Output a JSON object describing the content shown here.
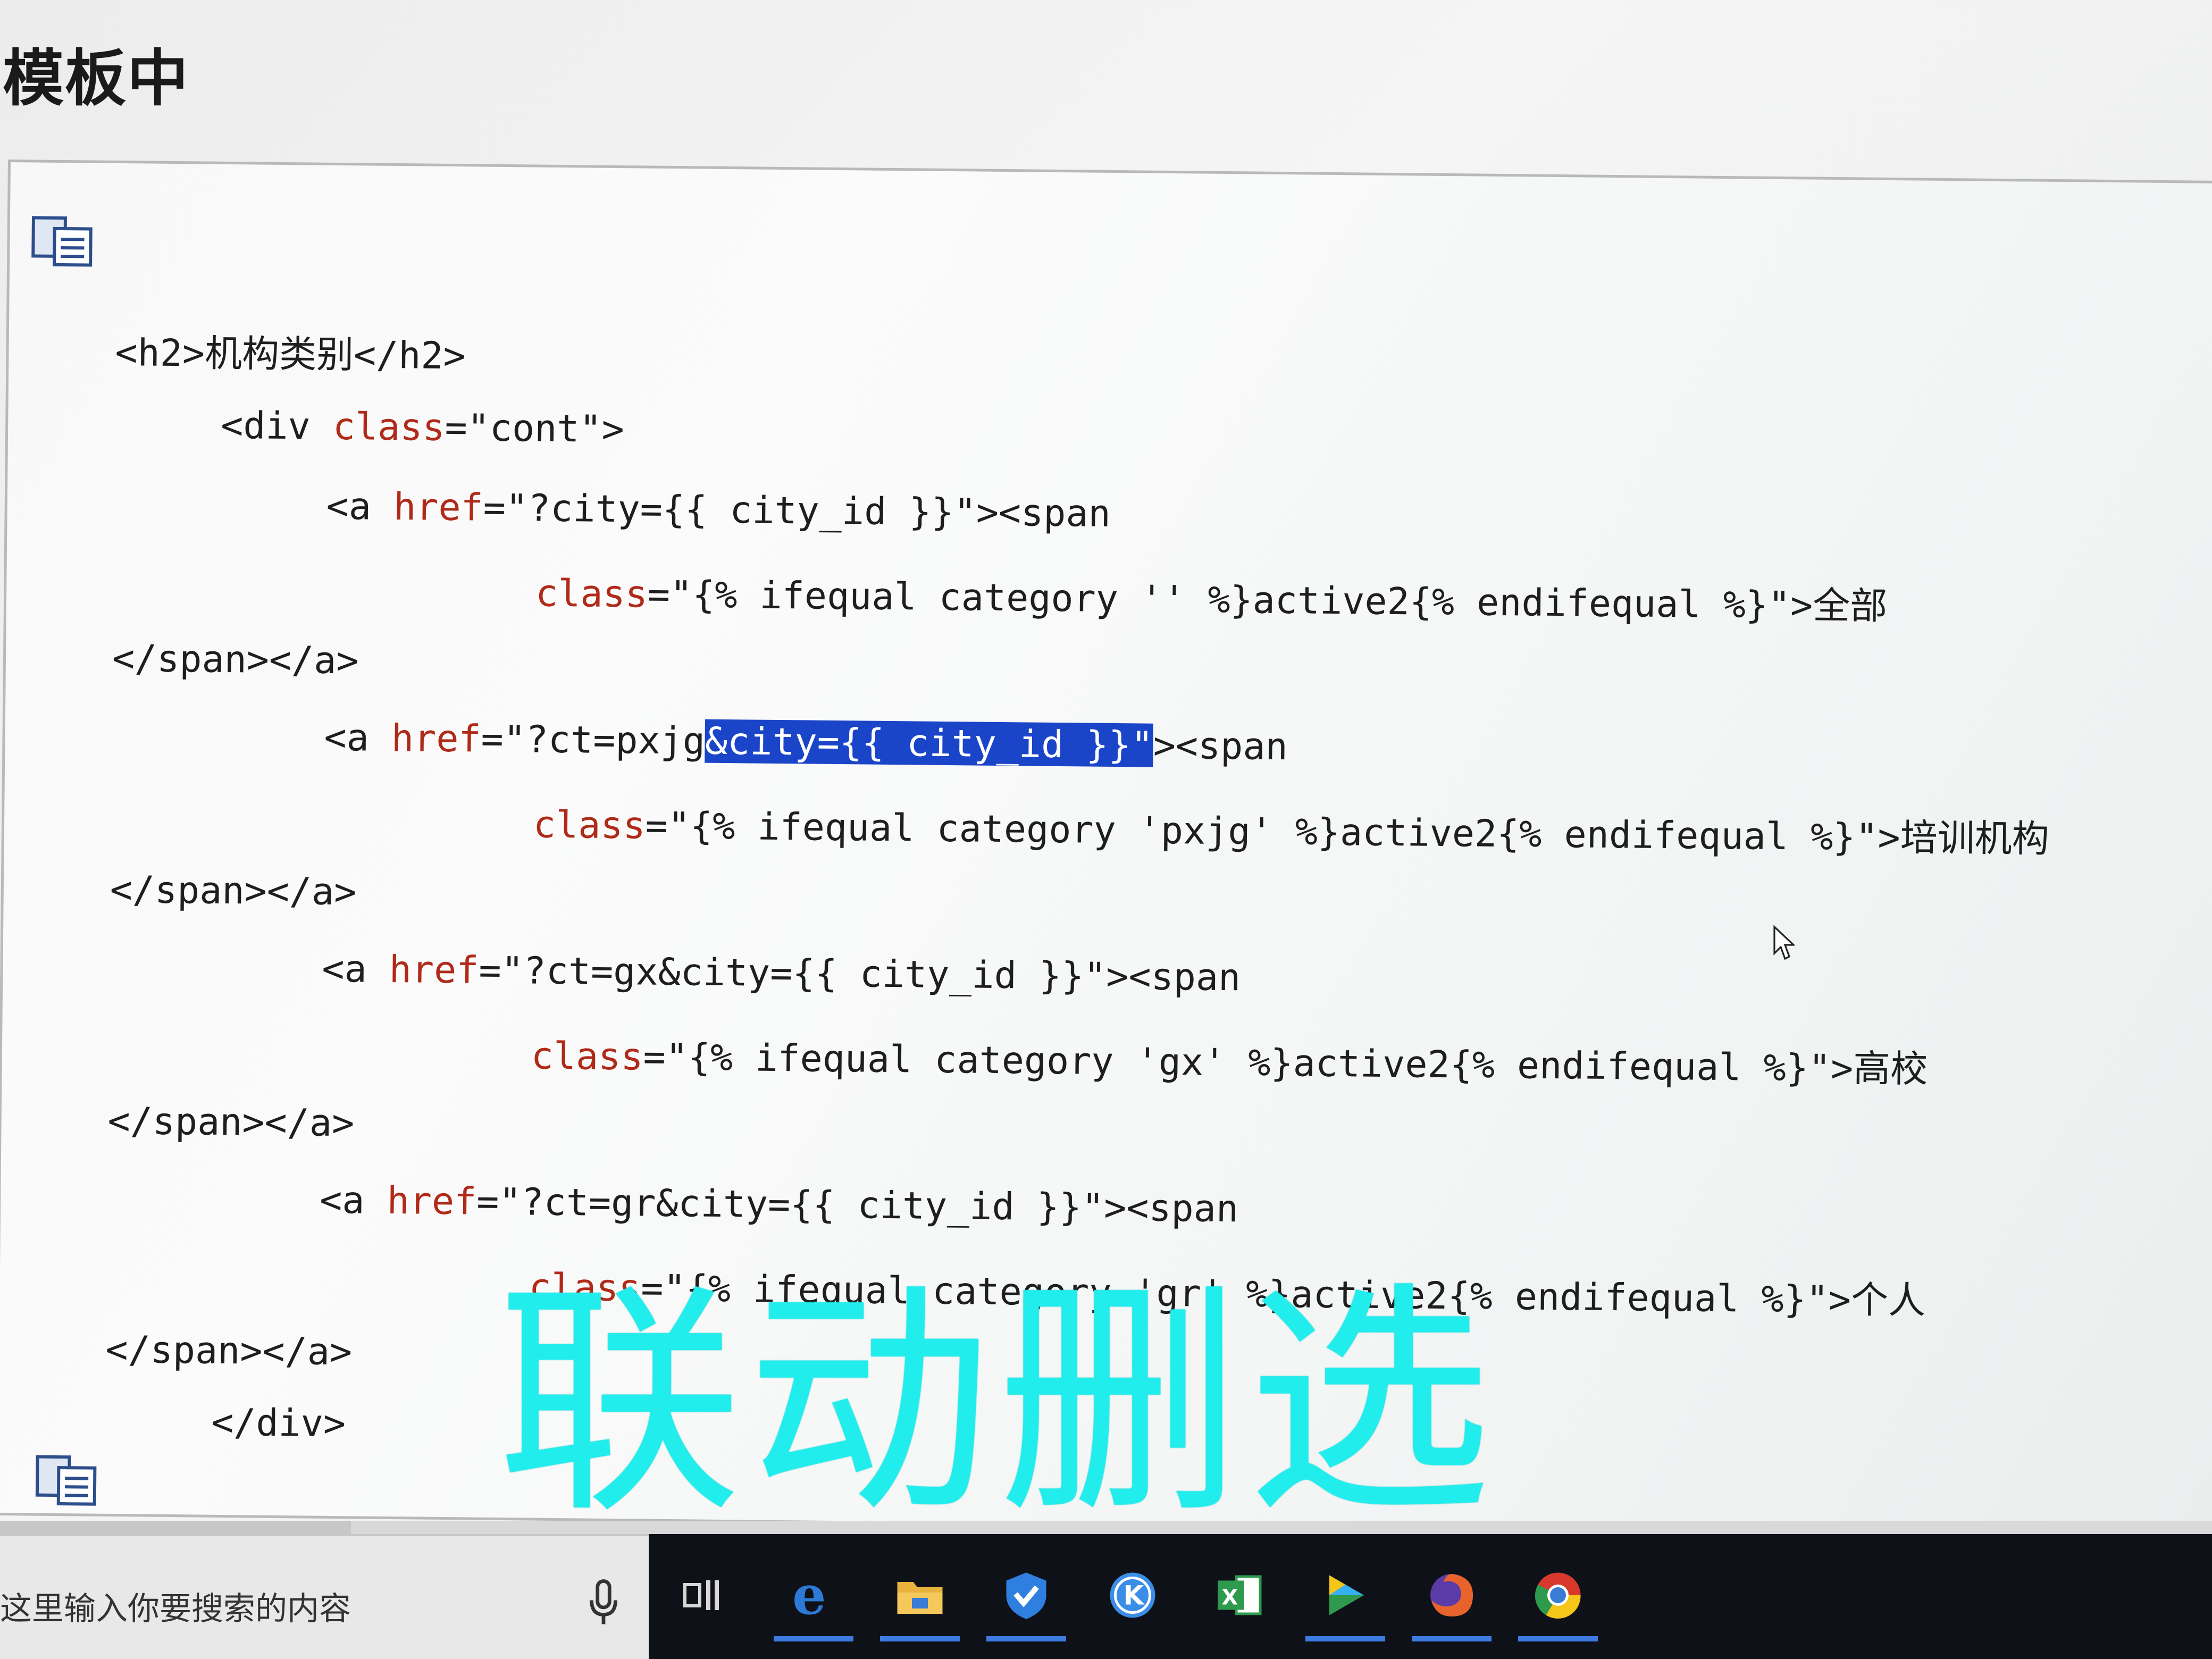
{
  "heading": "模板中",
  "code": {
    "lines": [
      {
        "id": "l1",
        "parts": [
          [
            "tag",
            "<h2>机构类别</h2>"
          ]
        ]
      },
      {
        "id": "l2",
        "parts": [
          [
            "tag",
            "<div "
          ],
          [
            "attr",
            "class"
          ],
          [
            "val",
            "=\"cont\">"
          ]
        ]
      },
      {
        "id": "l3",
        "parts": [
          [
            "tag",
            "<a "
          ],
          [
            "attr",
            "href"
          ],
          [
            "val",
            "=\"?city={{ city_id }}\"><span"
          ]
        ]
      },
      {
        "id": "l4",
        "parts": [
          [
            "attr",
            "class"
          ],
          [
            "val",
            "=\"{% ifequal category '' %}active2{% endifequal %}\">全部"
          ]
        ]
      },
      {
        "id": "l5",
        "parts": [
          [
            "tag",
            "</span></a>"
          ]
        ]
      },
      {
        "id": "l6",
        "parts": [
          [
            "tag",
            "<a "
          ],
          [
            "attr",
            "href"
          ],
          [
            "val",
            "=\"?ct=pxjg"
          ],
          [
            "sel",
            "&city={{ city_id }}\""
          ],
          [
            "val",
            "><span"
          ]
        ]
      },
      {
        "id": "l7",
        "parts": [
          [
            "attr",
            "class"
          ],
          [
            "val",
            "=\"{% ifequal category 'pxjg' %}active2{% endifequal %}\">培训机构"
          ]
        ]
      },
      {
        "id": "l8",
        "parts": [
          [
            "tag",
            "</span></a>"
          ]
        ]
      },
      {
        "id": "l9",
        "parts": [
          [
            "tag",
            "<a "
          ],
          [
            "attr",
            "href"
          ],
          [
            "val",
            "=\"?ct=gx&city={{ city_id }}\"><span"
          ]
        ]
      },
      {
        "id": "l10",
        "parts": [
          [
            "attr",
            "class"
          ],
          [
            "val",
            "=\"{% ifequal category 'gx' %}active2{% endifequal %}\">高校"
          ]
        ]
      },
      {
        "id": "l11",
        "parts": [
          [
            "tag",
            "</span></a>"
          ]
        ]
      },
      {
        "id": "l12",
        "parts": [
          [
            "tag",
            "<a "
          ],
          [
            "attr",
            "href"
          ],
          [
            "val",
            "=\"?ct=gr&city={{ city_id }}\"><span"
          ]
        ]
      },
      {
        "id": "l13",
        "parts": [
          [
            "attr",
            "class"
          ],
          [
            "val",
            "=\"{% ifequal category 'gr' %}active2{% endifequal %}\">个人"
          ]
        ]
      },
      {
        "id": "l14",
        "parts": [
          [
            "tag",
            "</span></a>"
          ]
        ]
      },
      {
        "id": "l15",
        "parts": [
          [
            "tag",
            "</div>"
          ]
        ]
      }
    ]
  },
  "overlay_caption": "联动删选",
  "taskbar": {
    "search_text": "这里输入你要搜索的内容",
    "items": [
      {
        "name": "task-view-icon",
        "color": "#d8d8d8"
      },
      {
        "name": "edge-icon",
        "color": "#2d7ad6"
      },
      {
        "name": "file-explorer-icon",
        "color": "#e8b23c"
      },
      {
        "name": "security-shield-icon",
        "color": "#2f7fe0"
      },
      {
        "name": "k-app-icon",
        "color": "#3a8ee8"
      },
      {
        "name": "excel-icon",
        "color": "#2e9a4e"
      },
      {
        "name": "video-player-icon",
        "color": "#35b0f0"
      },
      {
        "name": "firefox-icon",
        "color": "#e8632b"
      },
      {
        "name": "chrome-icon",
        "color": "#d9382d"
      }
    ]
  },
  "colors": {
    "selection": "#1b45c8",
    "caption": "#22eded",
    "attribute": "#b02a1a"
  }
}
